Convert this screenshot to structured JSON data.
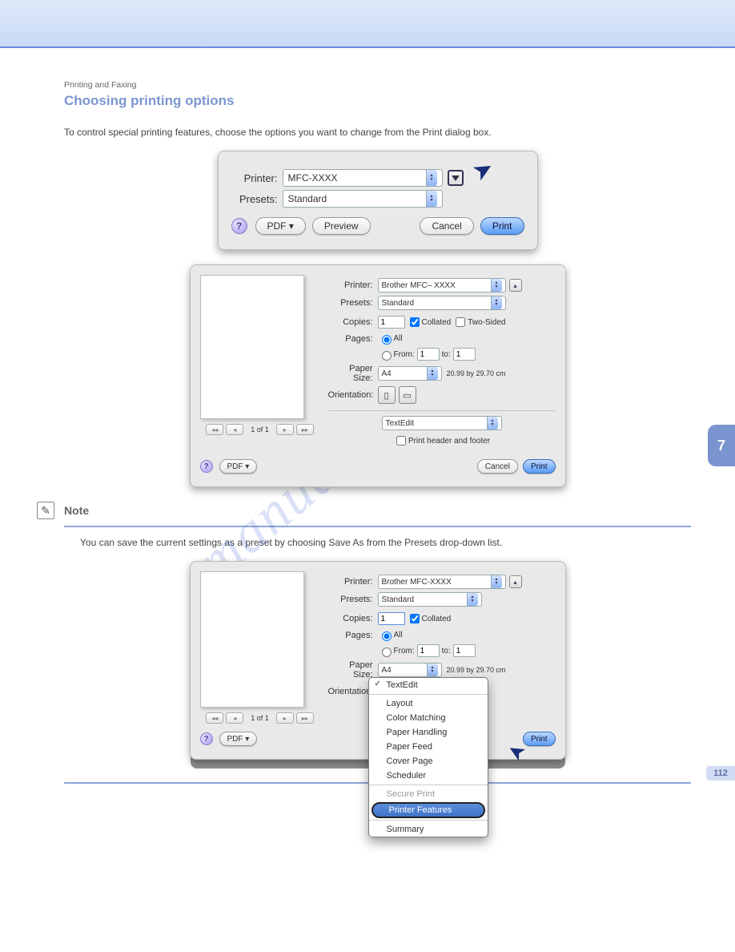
{
  "header": {
    "title": "Printing and Faxing"
  },
  "section_title": "Choosing printing options",
  "intro_text": "To control special printing features, choose the options you want to change from the Print dialog box.",
  "dialog1": {
    "printer_label": "Printer:",
    "printer_value": "MFC-XXXX",
    "presets_label": "Presets:",
    "presets_value": "Standard",
    "help": "?",
    "pdf": "PDF ▾",
    "preview": "Preview",
    "cancel": "Cancel",
    "print": "Print"
  },
  "dialog2": {
    "printer_label": "Printer:",
    "printer_value": "Brother  MFC– XXXX",
    "presets_label": "Presets:",
    "presets_value": "Standard",
    "copies_label": "Copies:",
    "copies_value": "1",
    "collated": "Collated",
    "twosided": "Two-Sided",
    "pages_label": "Pages:",
    "all": "All",
    "from_label": "From:",
    "from_value": "1",
    "to_label": "to:",
    "to_value": "1",
    "papersize_label": "Paper Size:",
    "papersize_value": "A4",
    "papersize_dim": "20.99 by 29.70 cm",
    "orientation_label": "Orientation:",
    "section_value": "TextEdit",
    "print_hf": "Print header and footer",
    "pager": "1 of 1",
    "help": "?",
    "pdf": "PDF ▾",
    "cancel": "Cancel",
    "print": "Print"
  },
  "note": {
    "label": "Note",
    "text": "You can save the current settings as a preset by choosing Save As from the Presets drop-down list."
  },
  "dialog3": {
    "printer_label": "Printer:",
    "printer_value": "Brother MFC-XXXX",
    "presets_label": "Presets:",
    "presets_value": "Standard",
    "copies_label": "Copies:",
    "copies_value": "1",
    "collated": "Collated",
    "pages_label": "Pages:",
    "all": "All",
    "from_label": "From:",
    "from_value": "1",
    "to_label": "to:",
    "to_value": "1",
    "papersize_label": "Paper Size:",
    "papersize_value": "A4",
    "papersize_dim": "20.99 by 29.70 cm",
    "orientation_label": "Orientation:",
    "menu": {
      "textedit": "TextEdit",
      "layout": "Layout",
      "colormatch": "Color Matching",
      "paperhandling": "Paper Handling",
      "paperfeed": "Paper Feed",
      "coverpage": "Cover Page",
      "scheduler": "Scheduler",
      "secure": "Secure Print",
      "features": "Printer Features",
      "summary": "Summary"
    },
    "pager": "1 of 1",
    "help": "?",
    "pdf": "PDF ▾",
    "print": "Print"
  },
  "tab": "7",
  "pageno": "112",
  "watermark": "manualshive.com"
}
